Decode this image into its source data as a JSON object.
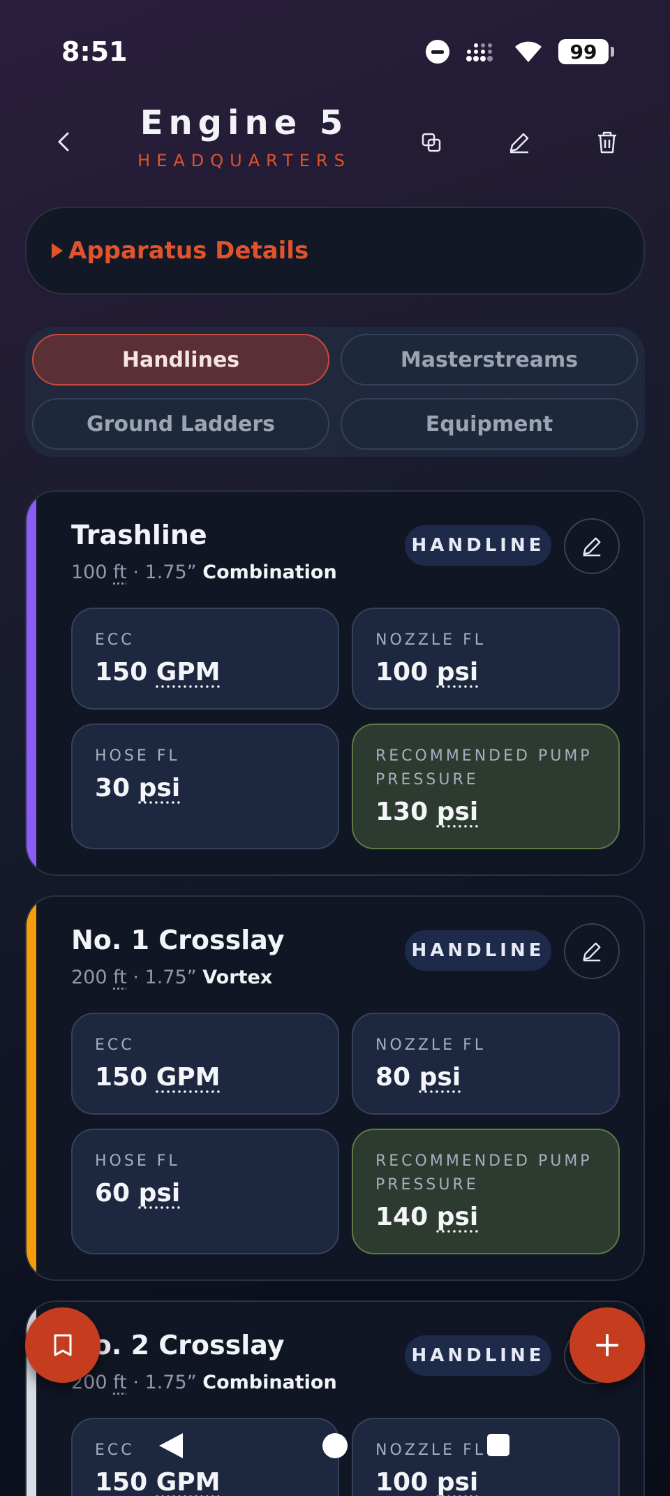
{
  "status": {
    "time": "8:51",
    "battery": "99"
  },
  "header": {
    "title": "Engine 5",
    "subtitle": "HEADQUARTERS"
  },
  "details": {
    "label": "Apparatus Details"
  },
  "tabs": [
    {
      "label": "Handlines",
      "active": true
    },
    {
      "label": "Masterstreams",
      "active": false
    },
    {
      "label": "Ground Ladders",
      "active": false
    },
    {
      "label": "Equipment",
      "active": false
    }
  ],
  "colors": {
    "accent": "#e0532b",
    "stripe_purple": "#8b5cf6",
    "stripe_orange": "#f59e0b",
    "stripe_light": "#d9dde6"
  },
  "hoses": [
    {
      "name": "Trashline",
      "length": "100",
      "length_unit": "ft",
      "separator": "·",
      "diameter": "1.75”",
      "nozzle": "Combination",
      "badge": "HANDLINE",
      "ecc_label": "ECC",
      "ecc_value": "150",
      "ecc_unit": "GPM",
      "nozzle_fl_label": "NOZZLE FL",
      "nozzle_fl_value": "100",
      "nozzle_fl_unit": "psi",
      "hose_fl_label": "HOSE FL",
      "hose_fl_value": "30",
      "hose_fl_unit": "psi",
      "rec_label": "RECOMMENDED PUMP PRESSURE",
      "rec_value": "130",
      "rec_unit": "psi"
    },
    {
      "name": "No. 1 Crosslay",
      "length": "200",
      "length_unit": "ft",
      "separator": "·",
      "diameter": "1.75”",
      "nozzle": "Vortex",
      "badge": "HANDLINE",
      "ecc_label": "ECC",
      "ecc_value": "150",
      "ecc_unit": "GPM",
      "nozzle_fl_label": "NOZZLE FL",
      "nozzle_fl_value": "80",
      "nozzle_fl_unit": "psi",
      "hose_fl_label": "HOSE FL",
      "hose_fl_value": "60",
      "hose_fl_unit": "psi",
      "rec_label": "RECOMMENDED PUMP PRESSURE",
      "rec_value": "140",
      "rec_unit": "psi"
    },
    {
      "name": "No. 2 Crosslay",
      "length": "200",
      "length_unit": "ft",
      "separator": "·",
      "diameter": "1.75”",
      "nozzle": "Combination",
      "badge": "HANDLINE",
      "ecc_label": "ECC",
      "ecc_value": "150",
      "ecc_unit": "GPM",
      "nozzle_fl_label": "NOZZLE FL",
      "nozzle_fl_value": "100",
      "nozzle_fl_unit": "psi"
    }
  ]
}
